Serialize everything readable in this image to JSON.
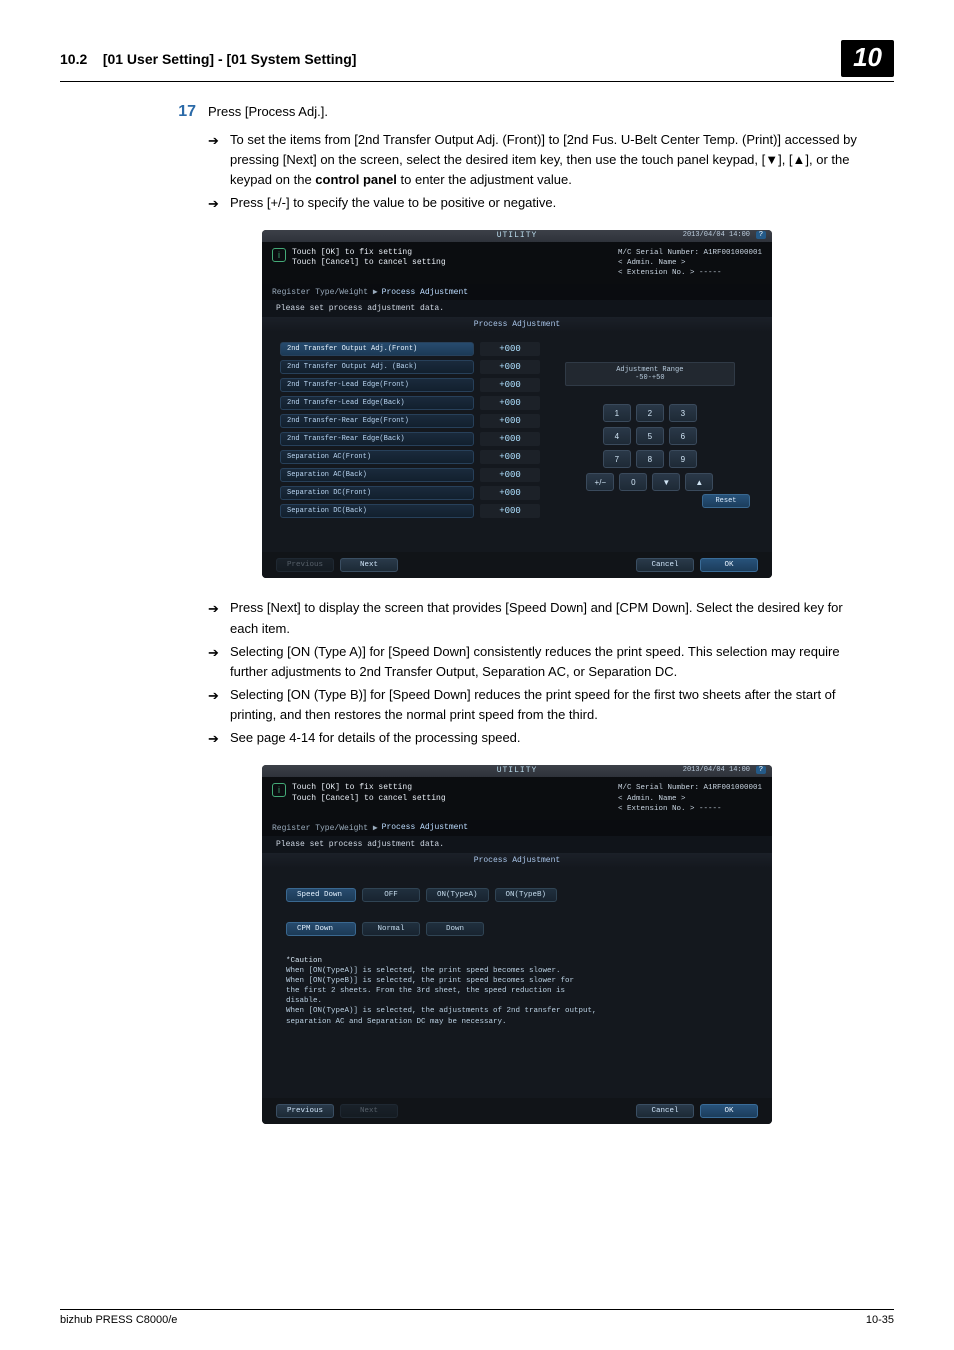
{
  "header": {
    "section": "10.2",
    "title": "[01 User Setting] - [01 System Setting]",
    "chapter": "10"
  },
  "step": {
    "number": "17",
    "text": "Press [Process Adj.]."
  },
  "bullets_top": [
    "To set the items from [2nd Transfer Output Adj. (Front)] to [2nd Fus. U-Belt Center Temp. (Print)] accessed by pressing [Next] on the screen, select the desired item key, then use the touch panel keypad, [▼], [▲], or the keypad on the control panel to enter the adjustment value.",
    "Press [+/-] to specify the value to be positive or negative."
  ],
  "bullets_bottom": [
    "Press [Next] to display the screen that provides [Speed Down] and [CPM Down]. Select the desired key for each item.",
    "Selecting [ON (Type A)] for [Speed Down] consistently reduces the print speed. This selection may require further adjustments to 2nd Transfer Output, Separation AC, or Separation DC.",
    "Selecting [ON (Type B)] for [Speed Down] reduces the print speed for the first two sheets after the start of printing, and then restores the normal print speed from the third.",
    "See page 4-14 for details of the processing speed."
  ],
  "ss_common": {
    "utility": "UTILITY",
    "date": "2013/04/04 14:00",
    "instr1": "Touch [OK] to fix setting",
    "instr2": "Touch [Cancel] to cancel setting",
    "serial": "M/C Serial Number: A1RF001000001",
    "admin": "< Admin. Name >",
    "ext": "< Extension No. > -----",
    "crumb1": "Register Type/Weight  ▶",
    "crumb2": "Process Adjustment",
    "subtitle": "Please set process adjustment data.",
    "tab": "Process Adjustment",
    "previous": "Previous",
    "next": "Next",
    "cancel": "Cancel",
    "ok": "OK",
    "reset": "Reset"
  },
  "ss1": {
    "rows": [
      {
        "label": "2nd Transfer Output Adj.(Front)",
        "val": "+000",
        "sel": true
      },
      {
        "label": "2nd Transfer Output Adj. (Back)",
        "val": "+000",
        "sel": false
      },
      {
        "label": "2nd Transfer-Lead Edge(Front)",
        "val": "+000",
        "sel": false
      },
      {
        "label": "2nd Transfer-Lead Edge(Back)",
        "val": "+000",
        "sel": false
      },
      {
        "label": "2nd Transfer-Rear Edge(Front)",
        "val": "+000",
        "sel": false
      },
      {
        "label": "2nd Transfer-Rear Edge(Back)",
        "val": "+000",
        "sel": false
      },
      {
        "label": "Separation AC(Front)",
        "val": "+000",
        "sel": false
      },
      {
        "label": "Separation AC(Back)",
        "val": "+000",
        "sel": false
      },
      {
        "label": "Separation DC(Front)",
        "val": "+000",
        "sel": false
      },
      {
        "label": "Separation DC(Back)",
        "val": "+000",
        "sel": false
      }
    ],
    "range_label": "Adjustment Range",
    "range_val": "-50-+50",
    "keys": [
      "1",
      "2",
      "3",
      "4",
      "5",
      "6",
      "7",
      "8",
      "9"
    ],
    "keys4": [
      "+/−",
      "0",
      "▼",
      "▲"
    ]
  },
  "ss2": {
    "row1": {
      "label": "Speed Down",
      "opts": [
        "OFF",
        "ON(TypeA)",
        "ON(TypeB)"
      ]
    },
    "row2": {
      "label": "CPM Down",
      "opts": [
        "Normal",
        "Down"
      ]
    },
    "caution_title": "*Caution",
    "caution_lines": [
      "When [ON(TypeA)] is selected, the print speed becomes slower.",
      "When [ON(TypeB)] is selected, the print speed becomes slower for",
      "the first 2 sheets. From the 3rd sheet, the speed reduction is",
      "disable.",
      "When [ON(TypeA)] is selected, the adjustments of 2nd transfer output,",
      "separation AC and Separation DC may be necessary."
    ]
  },
  "footer": {
    "left": "bizhub PRESS C8000/e",
    "right": "10-35"
  }
}
